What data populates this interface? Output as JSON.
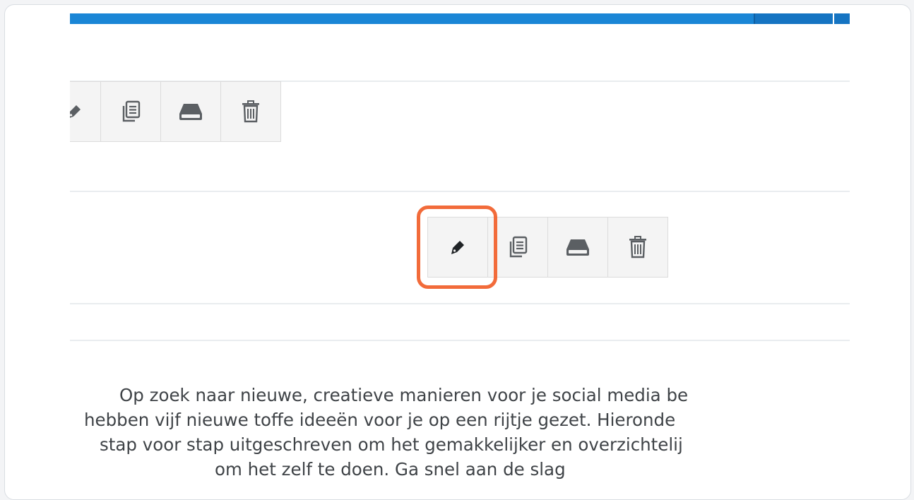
{
  "toolbars": [
    {
      "buttons": [
        {
          "icon": "pen-icon",
          "title": "Edit"
        },
        {
          "icon": "copy-icon",
          "title": "Duplicate"
        },
        {
          "icon": "save-icon",
          "title": "Save"
        },
        {
          "icon": "trash-icon",
          "title": "Delete"
        }
      ]
    },
    {
      "buttons": [
        {
          "icon": "pen-icon",
          "title": "Edit"
        },
        {
          "icon": "copy-icon",
          "title": "Duplicate"
        },
        {
          "icon": "save-icon",
          "title": "Save"
        },
        {
          "icon": "trash-icon",
          "title": "Delete"
        }
      ]
    }
  ],
  "highlight": {
    "target": "pen-icon",
    "color": "#f26b3a"
  },
  "article": {
    "lines": [
      "Op zoek naar nieuwe, creatieve manieren voor je social media be",
      "hebben vijf nieuwe toffe ideeën voor je op een rijtje gezet. Hieronde",
      "stap voor stap uitgeschreven om het gemakkelijker en overzichtelij",
      "om het zelf te doen. Ga snel aan de slag"
    ]
  },
  "colors": {
    "accent_bar": "#1a86d6",
    "highlight": "#f26b3a",
    "icon": "#5b5f63",
    "icon_active": "#1f2326"
  }
}
